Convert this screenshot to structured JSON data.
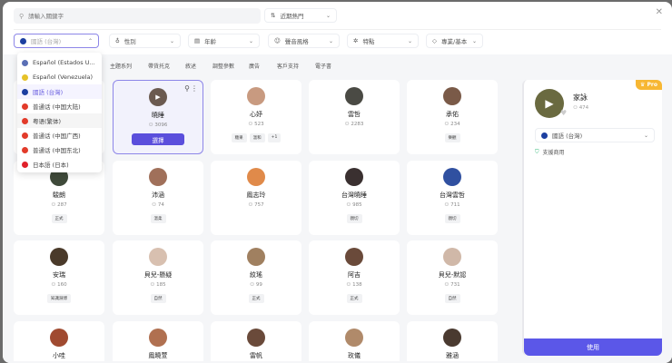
{
  "search": {
    "placeholder": "請輸入關鍵字"
  },
  "sort": {
    "value": "近期熱門"
  },
  "filters": {
    "language": "國語 (台灣)",
    "gender": "性別",
    "age": "年齡",
    "style": "聲音風格",
    "feature": "特點",
    "tier": "專業/基本"
  },
  "language_options": [
    {
      "label": "Español (Estados U...",
      "color": "#5a6fb5"
    },
    {
      "label": "Español (Venezuela)",
      "color": "#e6c229"
    },
    {
      "label": "國語 (台灣)",
      "color": "#1c3fa0",
      "active": true
    },
    {
      "label": "普通话 (中国大陆)",
      "color": "#e23b2a"
    },
    {
      "label": "粤语(繁体)",
      "color": "#e23b2a",
      "hover": true
    },
    {
      "label": "普通话 (中国广西)",
      "color": "#e23b2a"
    },
    {
      "label": "普通话 (中国东北)",
      "color": "#e23b2a"
    },
    {
      "label": "日本語 (日本)",
      "color": "#e0202a"
    }
  ],
  "tabs": [
    "主題系列",
    "帶貨托克",
    "敘述",
    "調整參數",
    "廣告",
    "客戶支持",
    "電子書"
  ],
  "select_label": "選擇",
  "voices": [
    {
      "name": "",
      "count": "",
      "tags": [],
      "color": "#ccc"
    },
    {
      "name": "曉睡",
      "count": "3096",
      "tags": [],
      "color": "#6b5a50",
      "selected": true
    },
    {
      "name": "心妤",
      "count": "523",
      "tags": [
        "糖果",
        "溫和",
        "+1"
      ],
      "color": "#c89a80"
    },
    {
      "name": "雲哲",
      "count": "2283",
      "tags": [],
      "color": "#4a4a44"
    },
    {
      "name": "承佑",
      "count": "234",
      "tags": [
        "樂觀"
      ],
      "color": "#7a5a48"
    },
    {
      "name": "駿朗",
      "count": "287",
      "tags": [
        "正式"
      ],
      "color": "#3f4a3a"
    },
    {
      "name": "沛涵",
      "count": "74",
      "tags": [
        "溫柔"
      ],
      "color": "#a0705a"
    },
    {
      "name": "鳳志玲",
      "count": "757",
      "tags": [],
      "color": "#e08a4a"
    },
    {
      "name": "台灣曉睡",
      "count": "985",
      "tags": [
        "親切"
      ],
      "color": "#3a3030"
    },
    {
      "name": "台灣雲哲",
      "count": "711",
      "tags": [
        "親切"
      ],
      "color": "#3050a0"
    },
    {
      "name": "安瑞",
      "count": "160",
      "tags": [
        "知識淵博"
      ],
      "color": "#4a3a2a"
    },
    {
      "name": "貝兒-懸疑",
      "count": "185",
      "tags": [
        "自然"
      ],
      "color": "#d8c0b0"
    },
    {
      "name": "紋瑤",
      "count": "99",
      "tags": [
        "正式"
      ],
      "color": "#a08060"
    },
    {
      "name": "阿吉",
      "count": "138",
      "tags": [
        "正式"
      ],
      "color": "#6a4a3a"
    },
    {
      "name": "貝兒-默認",
      "count": "731",
      "tags": [
        "自然"
      ],
      "color": "#d0b8a8"
    },
    {
      "name": "小哇",
      "count": "",
      "tags": [],
      "color": "#a04a30"
    },
    {
      "name": "鳳曉萱",
      "count": "",
      "tags": [],
      "color": "#b07050"
    },
    {
      "name": "雷帆",
      "count": "",
      "tags": [],
      "color": "#6a4a3a"
    },
    {
      "name": "玫儀",
      "count": "",
      "tags": [],
      "color": "#b08a6a"
    },
    {
      "name": "雅涵",
      "count": "",
      "tags": [],
      "color": "#4a3a30"
    }
  ],
  "panel": {
    "badge": "Pro",
    "name": "家詠",
    "count": "474",
    "language": "國語 (台灣)",
    "commercial": "支援商用",
    "use_label": "使用"
  },
  "colors": {
    "accent": "#5b4fdc",
    "pro": "#f7b733",
    "shield": "#2bb673"
  }
}
